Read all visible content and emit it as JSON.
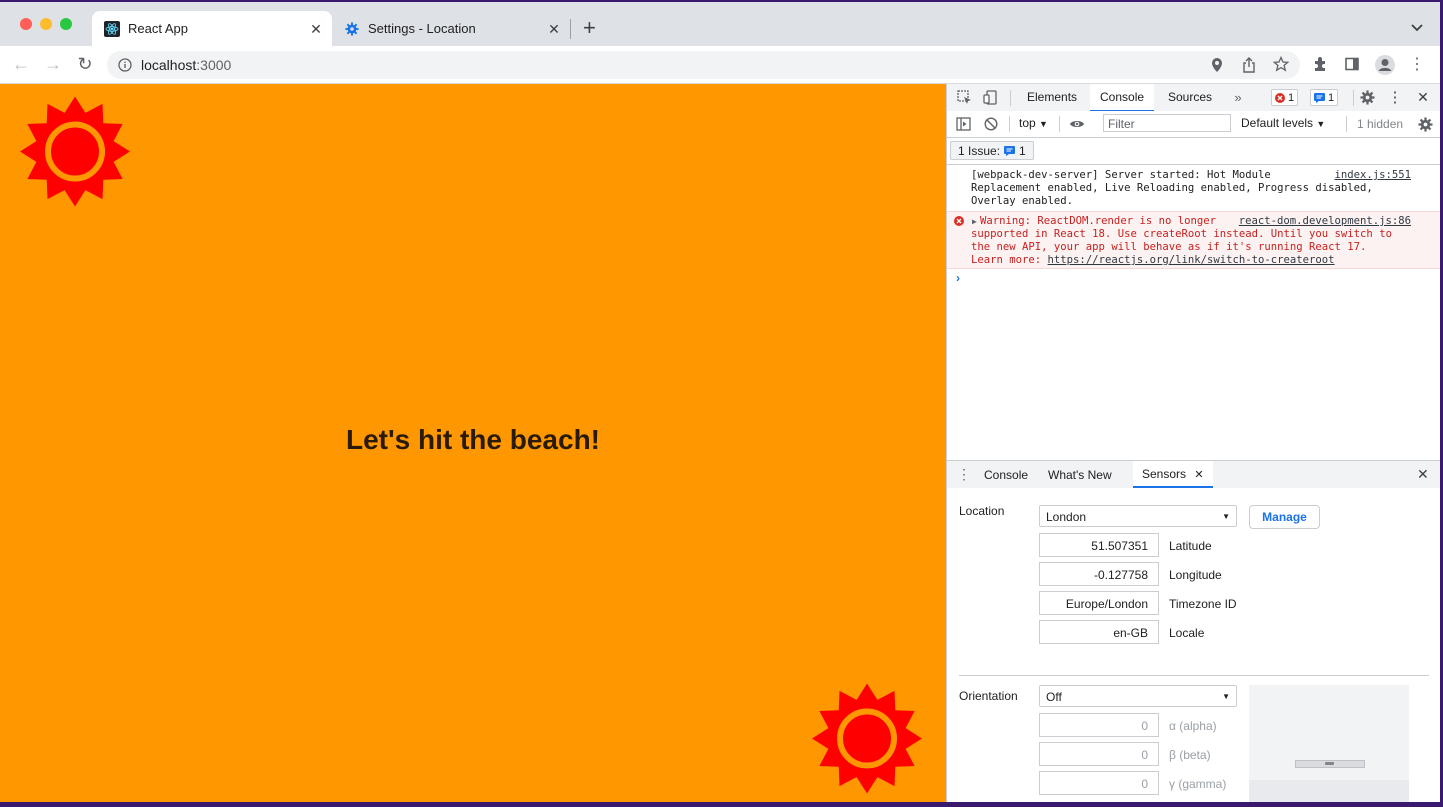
{
  "browser": {
    "tabs": [
      {
        "title": "React App",
        "icon": "react-icon"
      },
      {
        "title": "Settings - Location",
        "icon": "gear-icon"
      }
    ],
    "url_host": "localhost",
    "url_port": ":3000"
  },
  "page": {
    "heading": "Let's hit the beach!",
    "background_color": "#ff9800",
    "sun_color": "#ff0000"
  },
  "devtools": {
    "tabs": [
      "Elements",
      "Console",
      "Sources"
    ],
    "active_tab": "Console",
    "error_count": "1",
    "info_count": "1",
    "context": "top",
    "filter_placeholder": "Filter",
    "levels": "Default levels",
    "hidden": "1 hidden",
    "issues_label": "1 Issue:",
    "issues_count": "1",
    "messages": [
      {
        "text": "[webpack-dev-server] Server started: Hot Module\nReplacement enabled, Live Reloading enabled, Progress disabled,\nOverlay enabled.",
        "source": "index.js:551"
      },
      {
        "text": "Warning: ReactDOM.render is no longer\nsupported in React 18. Use createRoot instead. Until you switch to\nthe new API, your app will behave as if it's running React 17.\nLearn more: ",
        "link": "https://reactjs.org/link/switch-to-createroot",
        "source": "react-dom.development.js:86"
      }
    ],
    "drawer_tabs": [
      "Console",
      "What's New",
      "Sensors"
    ],
    "sensors": {
      "location_label": "Location",
      "location_value": "London",
      "manage": "Manage",
      "latitude": "51.507351",
      "latitude_label": "Latitude",
      "longitude": "-0.127758",
      "longitude_label": "Longitude",
      "timezone": "Europe/London",
      "timezone_label": "Timezone ID",
      "locale": "en-GB",
      "locale_label": "Locale",
      "orientation_label": "Orientation",
      "orientation_value": "Off",
      "alpha": "0",
      "alpha_label": "α (alpha)",
      "beta": "0",
      "beta_label": "β (beta)",
      "gamma": "0",
      "gamma_label": "γ (gamma)"
    }
  }
}
